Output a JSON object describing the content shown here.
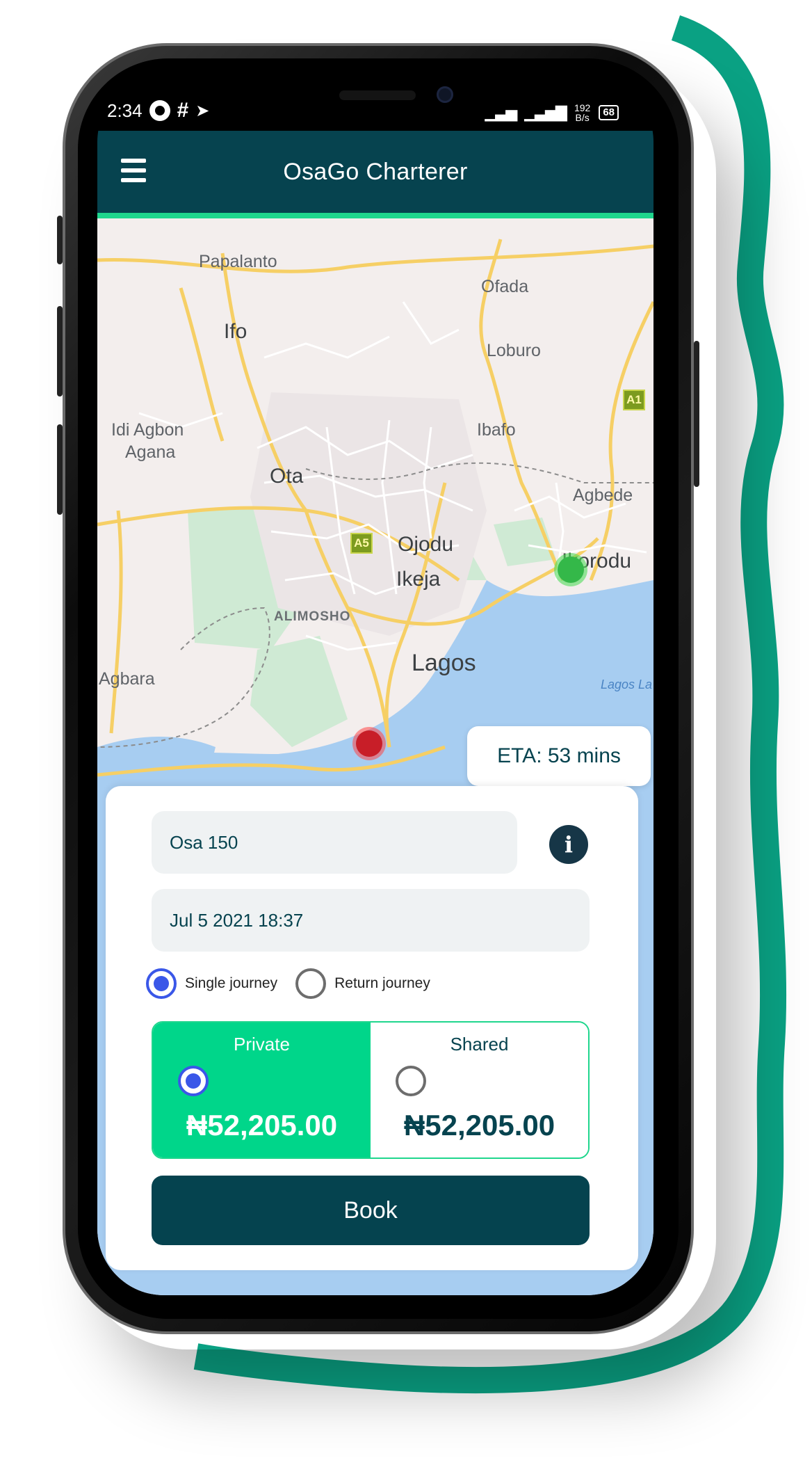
{
  "status_bar": {
    "time": "2:34",
    "net_speed_value": "192",
    "net_speed_unit": "B/s",
    "battery": "68"
  },
  "header": {
    "title": "OsaGo Charterer"
  },
  "map": {
    "labels": {
      "papalanto": "Papalanto",
      "ofada": "Ofada",
      "ifo": "Ifo",
      "loburo": "Loburo",
      "idi_agbon": "Idi Agbon",
      "agana": "Agana",
      "ibafo": "Ibafo",
      "ota": "Ota",
      "agbede": "Agbede",
      "ojodu": "Ojodu",
      "ikorodu": "Ikorodu",
      "ikeja": "Ikeja",
      "alimosho": "ALIMOSHO",
      "lagos": "Lagos",
      "agbara": "Agbara",
      "lagos_lagoon": "Lagos La"
    },
    "shields": {
      "a1": "A1",
      "a5": "A5"
    },
    "eta": "ETA: 53 mins"
  },
  "booking": {
    "vehicle": "Osa 150",
    "datetime": "Jul 5 2021 18:37",
    "journey_options": [
      "Single journey",
      "Return journey"
    ],
    "selected_journey": "Single journey",
    "seat_options": [
      {
        "label": "Private",
        "price": "₦52,205.00",
        "selected": true
      },
      {
        "label": "Shared",
        "price": "₦52,205.00",
        "selected": false
      }
    ],
    "book_label": "Book"
  },
  "colors": {
    "header_bg": "#06434f",
    "accent_green": "#00d68a",
    "radio_blue": "#3a57e8",
    "ribbon": "#0aa183"
  }
}
